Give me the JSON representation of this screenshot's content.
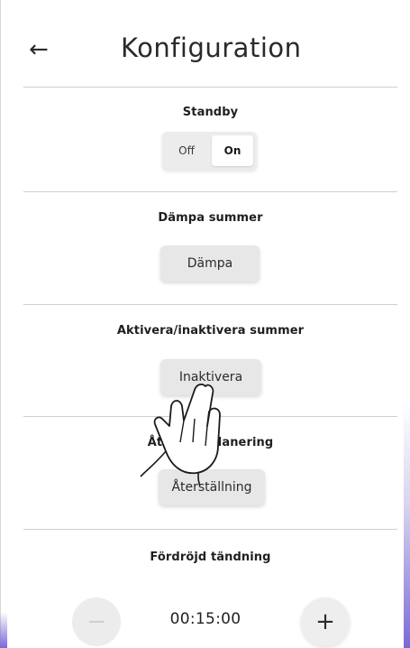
{
  "header": {
    "back_icon": "back-arrow-icon",
    "title": "Konfiguration"
  },
  "sections": {
    "standby": {
      "label": "Standby",
      "options": {
        "off": "Off",
        "on": "On"
      },
      "selected": "On"
    },
    "mute": {
      "label": "Dämpa summer",
      "button": "Dämpa"
    },
    "buzzer": {
      "label": "Aktivera/inaktivera summer",
      "button": "Inaktivera"
    },
    "reset": {
      "label": "Återställ planering",
      "button": "Återställning"
    },
    "delayed_ignition": {
      "label": "Fördröjd tändning",
      "value": "00:15:00",
      "minus_icon": "minus-icon",
      "plus_icon": "plus-icon"
    }
  },
  "overlay": {
    "gesture_icon": "tap-hand-icon"
  },
  "colors": {
    "accent": "#7a6ad6",
    "button_bg": "#e7e7e7",
    "divider": "#cfcfcf"
  }
}
